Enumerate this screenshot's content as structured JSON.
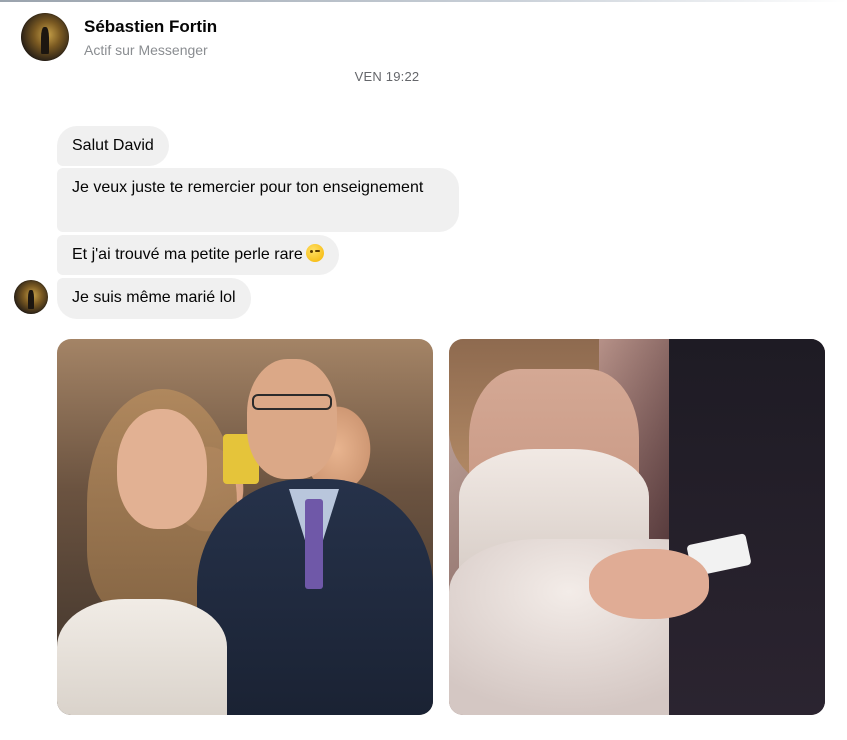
{
  "header": {
    "name": "Sébastien Fortin",
    "status": "Actif sur Messenger"
  },
  "timestamp": "VEN 19:22",
  "messages": [
    {
      "text": "Salut David"
    },
    {
      "text": "Je veux juste te remercier pour ton enseignement"
    },
    {
      "text": "Et j'ai trouvé ma petite perle rare",
      "emoji": "winking-face-emoji"
    },
    {
      "text": "Je suis même marié lol"
    }
  ],
  "attachments": [
    {
      "icon": "photo-wedding-couple"
    },
    {
      "icon": "photo-wedding-hands"
    }
  ],
  "colors": {
    "bubble_bg": "#f0f0f0",
    "name_text": "#050505",
    "secondary_text": "#8a8d91"
  }
}
